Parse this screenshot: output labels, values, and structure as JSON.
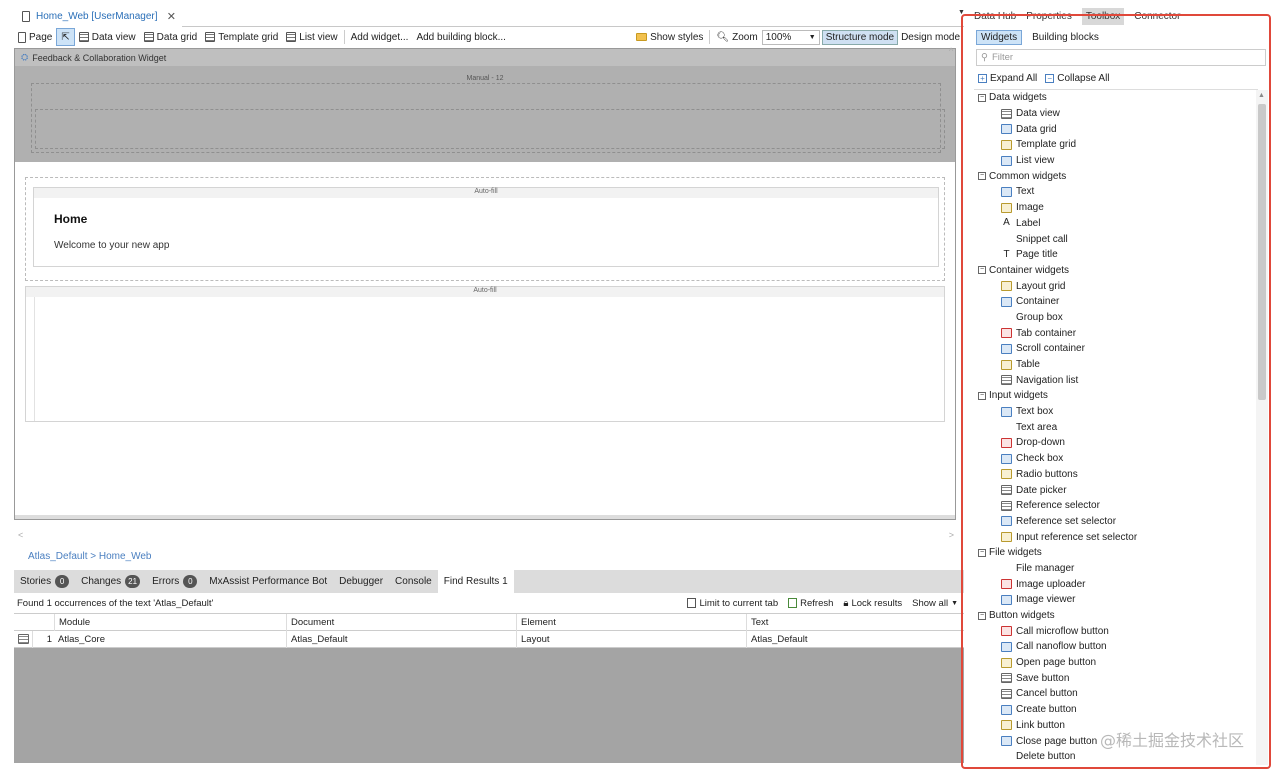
{
  "doc_tab": {
    "title": "Home_Web [UserManager]",
    "close": "✕"
  },
  "right_tabs": [
    "Data Hub",
    "Properties",
    "Toolbox",
    "Connector"
  ],
  "toolbar": {
    "page": "Page",
    "data_view": "Data view",
    "data_grid": "Data grid",
    "template_grid": "Template grid",
    "list_view": "List view",
    "add_widget": "Add widget...",
    "add_building_block": "Add building block...",
    "show_styles": "Show styles",
    "zoom_label": "Zoom",
    "zoom_value": "100%",
    "structure_mode": "Structure mode",
    "design_mode": "Design mode"
  },
  "canvas": {
    "widget_title": "Feedback & Collaboration Widget",
    "manual_label": "Manual - 12",
    "auto_fill_1": "Auto-fill",
    "home_title": "Home",
    "home_subtitle": "Welcome to your new app",
    "auto_fill_2": "Auto-fill"
  },
  "breadcrumb": "Atlas_Default  >  Home_Web",
  "bottom_tabs": [
    {
      "label": "Stories",
      "badge": "0"
    },
    {
      "label": "Changes",
      "badge": "21"
    },
    {
      "label": "Errors",
      "badge": "0"
    },
    {
      "label": "MxAssist Performance Bot",
      "badge": ""
    },
    {
      "label": "Debugger",
      "badge": ""
    },
    {
      "label": "Console",
      "badge": ""
    },
    {
      "label": "Find Results 1",
      "badge": ""
    }
  ],
  "find": {
    "summary": "Found 1 occurrences of the text 'Atlas_Default'",
    "limit": "Limit to current tab",
    "refresh": "Refresh",
    "lock": "Lock results",
    "show_all": "Show all"
  },
  "results": {
    "headers": [
      "Module",
      "Document",
      "Element",
      "Text"
    ],
    "row": {
      "index": "1",
      "module": "Atlas_Core",
      "document": "Atlas_Default",
      "element": "Layout",
      "text": "Atlas_Default"
    }
  },
  "toolbox": {
    "tabs": [
      "Widgets",
      "Building blocks"
    ],
    "filter_placeholder": "Filter",
    "expand_all": "Expand All",
    "collapse_all": "Collapse All",
    "groups": [
      {
        "name": "Data widgets",
        "items": [
          "Data view",
          "Data grid",
          "Template grid",
          "List view"
        ]
      },
      {
        "name": "Common widgets",
        "items": [
          "Text",
          "Image",
          "Label",
          "Snippet call",
          "Page title"
        ]
      },
      {
        "name": "Container widgets",
        "items": [
          "Layout grid",
          "Container",
          "Group box",
          "Tab container",
          "Scroll container",
          "Table",
          "Navigation list"
        ]
      },
      {
        "name": "Input widgets",
        "items": [
          "Text box",
          "Text area",
          "Drop-down",
          "Check box",
          "Radio buttons",
          "Date picker",
          "Reference selector",
          "Reference set selector",
          "Input reference set selector"
        ]
      },
      {
        "name": "File widgets",
        "items": [
          "File manager",
          "Image uploader",
          "Image viewer"
        ]
      },
      {
        "name": "Button widgets",
        "items": [
          "Call microflow button",
          "Call nanoflow button",
          "Open page button",
          "Save button",
          "Cancel button",
          "Create button",
          "Link button",
          "Close page button",
          "Delete button"
        ]
      }
    ]
  },
  "watermark": "@稀土掘金技术社区",
  "colors": {
    "highlight": "#e0483a",
    "link": "#2a6fb8"
  }
}
